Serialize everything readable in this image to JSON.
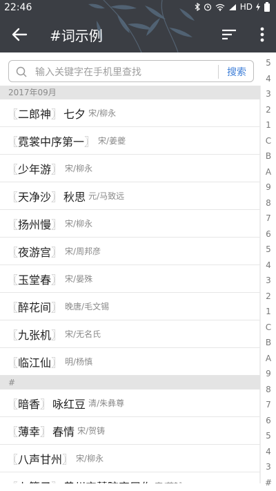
{
  "status_bar": {
    "time": "22:46",
    "network": "HD"
  },
  "app_bar": {
    "title": "#词示例",
    "back_icon": "arrow-left-icon",
    "sort_icon": "sort-icon",
    "menu_icon": "more-vert-icon"
  },
  "search": {
    "placeholder": "输入关键字在手机里查找",
    "button": "搜索"
  },
  "sections": [
    {
      "header": "2017年09月",
      "items": [
        {
          "name": "二郎神",
          "sub": "七夕",
          "author": "宋/柳永"
        },
        {
          "name": "霓裳中序第一",
          "sub": "",
          "author": "宋/姜夔"
        },
        {
          "name": "少年游",
          "sub": "",
          "author": "宋/柳永"
        },
        {
          "name": "天净沙",
          "sub": "秋思",
          "author": "元/马致远"
        },
        {
          "name": "扬州慢",
          "sub": "",
          "author": "宋/柳永"
        },
        {
          "name": "夜游宫",
          "sub": "",
          "author": "宋/周邦彦"
        },
        {
          "name": "玉堂春",
          "sub": "",
          "author": "宋/晏殊"
        },
        {
          "name": "醉花间",
          "sub": "",
          "author": "晚唐/毛文锡"
        },
        {
          "name": "九张机",
          "sub": "",
          "author": "宋/无名氏"
        },
        {
          "name": "临江仙",
          "sub": "",
          "author": "明/杨慎"
        }
      ]
    },
    {
      "header": "#",
      "items": [
        {
          "name": "暗香",
          "sub": "咏红豆",
          "author": "清/朱彝尊"
        },
        {
          "name": "薄幸",
          "sub": "春情",
          "author": "宋/贺铸"
        },
        {
          "name": "八声甘州",
          "sub": "",
          "author": "宋/柳永"
        },
        {
          "name": "卜算子",
          "sub": "黄州定慧院寓居作",
          "author": "宋/苏轼"
        }
      ]
    }
  ],
  "index_letters": [
    "5",
    "4",
    "3",
    "2",
    "1",
    "C",
    "B",
    "A",
    "9",
    "8",
    "7",
    "6",
    "5",
    "4",
    "3",
    "2",
    "1",
    "C",
    "B",
    "A",
    "9",
    "8",
    "7",
    "6",
    "5",
    "4",
    "3",
    "#"
  ],
  "colors": {
    "app_bar": "#3b3e44",
    "accent": "#3f7fd8",
    "section_bg": "#e4e4e4"
  }
}
